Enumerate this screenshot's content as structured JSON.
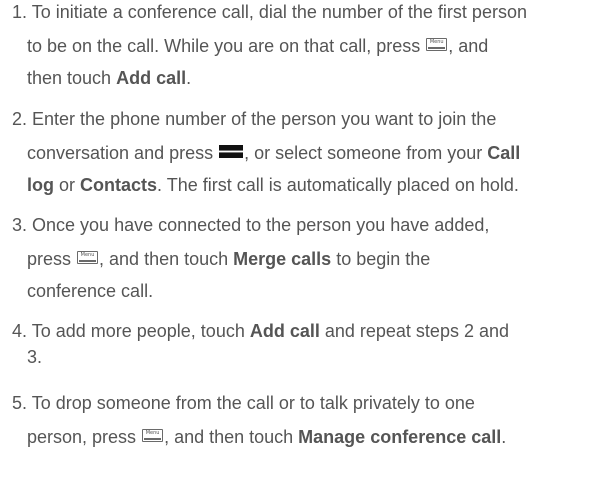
{
  "steps": [
    {
      "number": "1.",
      "line1": " To initiate a conference call, dial the number of the first person",
      "line2_a": "to be on the call. While you are on that call, press ",
      "line2_b": ", and",
      "line3_a": "then touch ",
      "line3_bold": "Add call",
      "line3_b": "."
    },
    {
      "number": "2.",
      "line1": " Enter the phone number of the person you want to join the",
      "line2_a": "conversation and press ",
      "line2_b": ", or select someone from your ",
      "line2_bold": "Call",
      "line3_bold1": "log",
      "line3_a": " or ",
      "line3_bold2": "Contacts",
      "line3_b": ". The first call is automatically placed on hold."
    },
    {
      "number": "3.",
      "line1": " Once you have connected to the person you have added,",
      "line2_a": "press ",
      "line2_b": ", and then touch ",
      "line2_bold": "Merge calls",
      "line2_c": " to begin the",
      "line3": "conference call."
    },
    {
      "number": "4.",
      "line1_a": " To add more people, touch ",
      "line1_bold": "Add call",
      "line1_b": " and repeat steps 2 and",
      "line2": "3."
    },
    {
      "number": "5.",
      "line1": " To drop someone from the call or to talk privately to one",
      "line2_a": "person, press ",
      "line2_b": ", and then touch ",
      "line2_bold": "Manage conference call",
      "line2_c": "."
    }
  ],
  "icons": {
    "menu_key_label": "Menu",
    "menu_key": "menu-key-icon",
    "send_key": "send-key-icon"
  }
}
